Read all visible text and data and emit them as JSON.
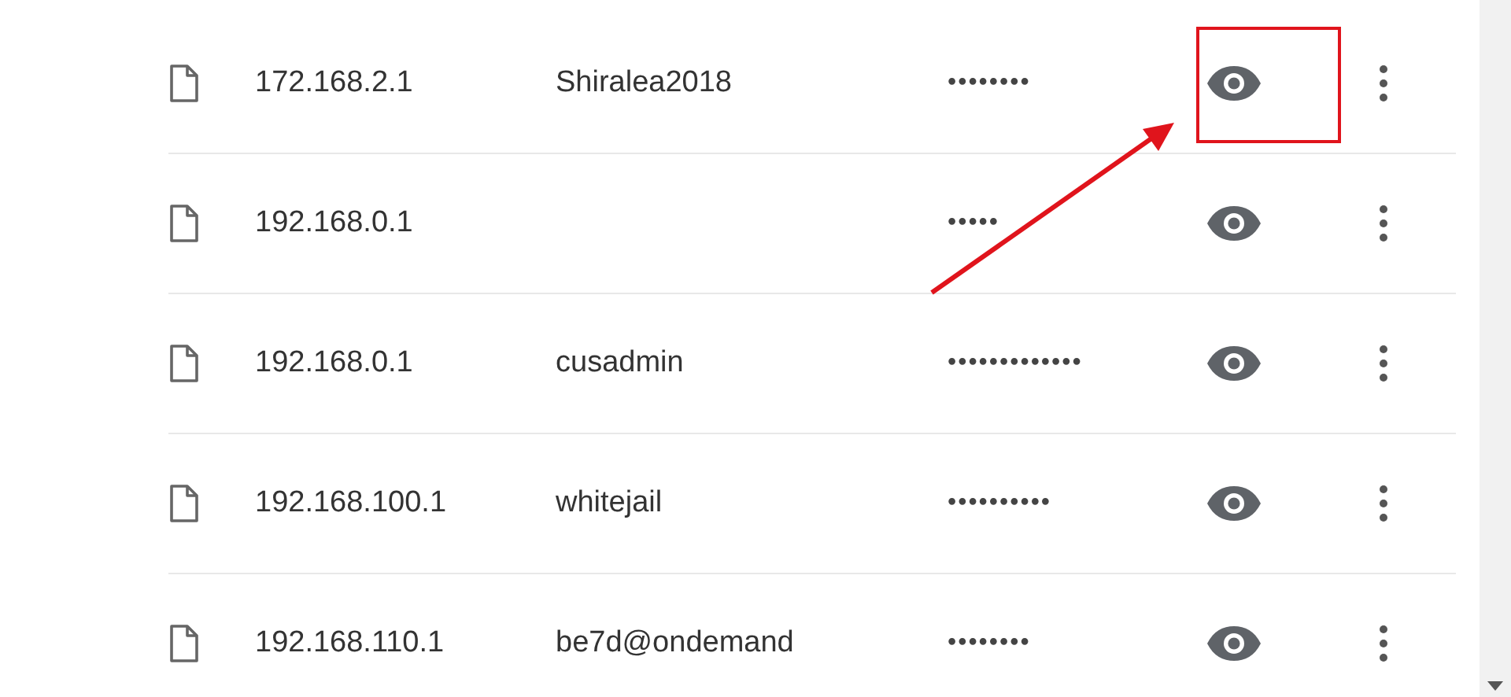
{
  "passwords": [
    {
      "site": "172.168.2.1",
      "username": "Shiralea2018",
      "password": "••••••••",
      "highlighted": true
    },
    {
      "site": "192.168.0.1",
      "password": "•••••",
      "highlighted": false
    },
    {
      "site": "192.168.0.1",
      "username": "cusadmin",
      "password": "•••••••••••••",
      "highlighted": false
    },
    {
      "site": "192.168.100.1",
      "username": "whitejail",
      "password": "••••••••••",
      "highlighted": false
    },
    {
      "site": "192.168.110.1",
      "username": "be7d@ondemand",
      "password": "••••••••",
      "highlighted": false
    }
  ]
}
